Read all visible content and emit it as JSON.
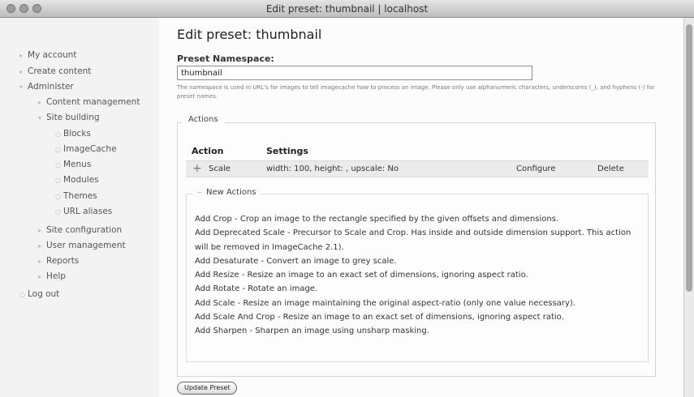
{
  "window": {
    "title": "Edit preset: thumbnail | localhost"
  },
  "sidebar": {
    "items": [
      {
        "label": "My account"
      },
      {
        "label": "Create content"
      },
      {
        "label": "Administer"
      },
      {
        "label": "Content management"
      },
      {
        "label": "Site building"
      },
      {
        "label": "Blocks"
      },
      {
        "label": "ImageCache"
      },
      {
        "label": "Menus"
      },
      {
        "label": "Modules"
      },
      {
        "label": "Themes"
      },
      {
        "label": "URL aliases"
      },
      {
        "label": "Site configuration"
      },
      {
        "label": "User management"
      },
      {
        "label": "Reports"
      },
      {
        "label": "Help"
      },
      {
        "label": "Log out"
      }
    ]
  },
  "main": {
    "page_title": "Edit preset: thumbnail",
    "namespace_label": "Preset Namespace:",
    "namespace_value": "thumbnail",
    "namespace_help": "The namespace is used in URL's for images to tell imagecache how to process an image. Please only use alphanumeric characters, underscores (_), and hyphens (-) for preset names.",
    "actions_legend": "Actions",
    "table": {
      "headers": [
        "Action",
        "Settings"
      ],
      "rows": [
        {
          "drag": "+",
          "action": "Scale",
          "settings": "width: 100, height: , upscale: No",
          "configure": "Configure",
          "delete": "Delete"
        }
      ]
    },
    "new_actions_legend": "New Actions",
    "new_actions_toggle": "–",
    "new_actions": [
      "Add Crop - Crop an image to the rectangle specified by the given offsets and dimensions.",
      "Add Deprecated Scale - Precursor to Scale and Crop. Has inside and outside dimension support. This action will be removed in ImageCache 2.1).",
      "Add Desaturate - Convert an image to grey scale.",
      "Add Resize - Resize an image to an exact set of dimensions, ignoring aspect ratio.",
      "Add Rotate - Rotate an image.",
      "Add Scale - Resize an image maintaining the original aspect-ratio (only one value necessary).",
      "Add Scale And Crop - Resize an image to an exact set of dimensions, ignoring aspect ratio.",
      "Add Sharpen - Sharpen an image using unsharp masking."
    ],
    "update_button": "Update Preset"
  }
}
